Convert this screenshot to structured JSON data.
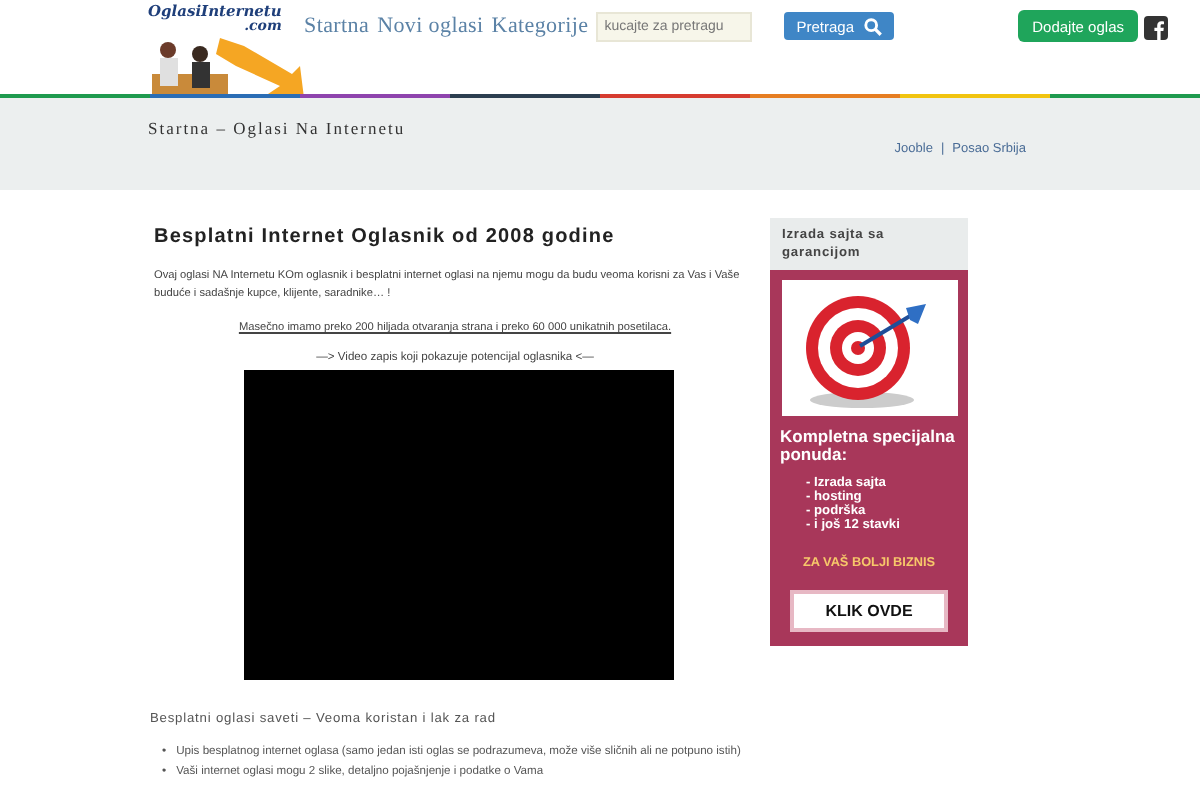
{
  "header": {
    "logo": {
      "line_1": "OglasiInternetu",
      "line_2": ".com"
    },
    "nav": [
      {
        "label": "Startna"
      },
      {
        "label": "Novi oglasi"
      },
      {
        "label": "Kategorije"
      }
    ],
    "search": {
      "placeholder": "kucajte za pretragu"
    },
    "search_button": "Pretraga",
    "add_button": "Dodajte oglas"
  },
  "stripe": [
    {
      "color": "#1e9a4e"
    },
    {
      "color": "#2a6db5"
    },
    {
      "color": "#8e44ad"
    },
    {
      "color": "#2c3e50"
    },
    {
      "color": "#d63b2f"
    },
    {
      "color": "#e67e22"
    },
    {
      "color": "#f1c40f"
    },
    {
      "color": "#1e9a4e"
    }
  ],
  "breadcrumb": "Startna – Oglasi Na Internetu",
  "top_links": [
    {
      "label": "Jooble"
    },
    {
      "label": "Posao Srbija"
    }
  ],
  "top_links_separator": "|",
  "article": {
    "title": "Besplatni Internet Oglasnik od 2008 godine",
    "intro": "Ovaj oglasi NA Internetu KOm oglasnik i besplatni internet oglasi na njemu mogu da budu veoma korisni za Vas i Vaše buduće i sadašnje kupce, klijente, saradnike… !",
    "stats_link": "Masečno imamo preko 200 hiljada otvaranja strana i preko 60 000 unikatnih posetilaca.",
    "video_caption": "—> Video zapis koji pokazuje potencijal oglasnika <—",
    "tips_heading": "Besplatni oglasi saveti – Veoma koristan i lak za rad",
    "tip_bullet": "•",
    "tips": [
      "Upis besplatnog internet oglasa (samo jedan isti oglas se podrazumeva, može više sličnih ali ne potpuno istih)",
      "Vaši internet oglasi mogu 2 slike, detaljno pojašnjenje i podatke o Vama"
    ]
  },
  "sidebar": {
    "heading": "Izrada sajta sa garancijom",
    "banner": {
      "headline": "Kompletna specijalna ponuda:",
      "items": [
        "- Izrada sajta",
        "- hosting",
        "- podrška",
        "- i još 12 stavki"
      ],
      "slogan": "ZA VAŠ BOLJI BIZNIS",
      "button": "KLIK OVDE"
    }
  }
}
